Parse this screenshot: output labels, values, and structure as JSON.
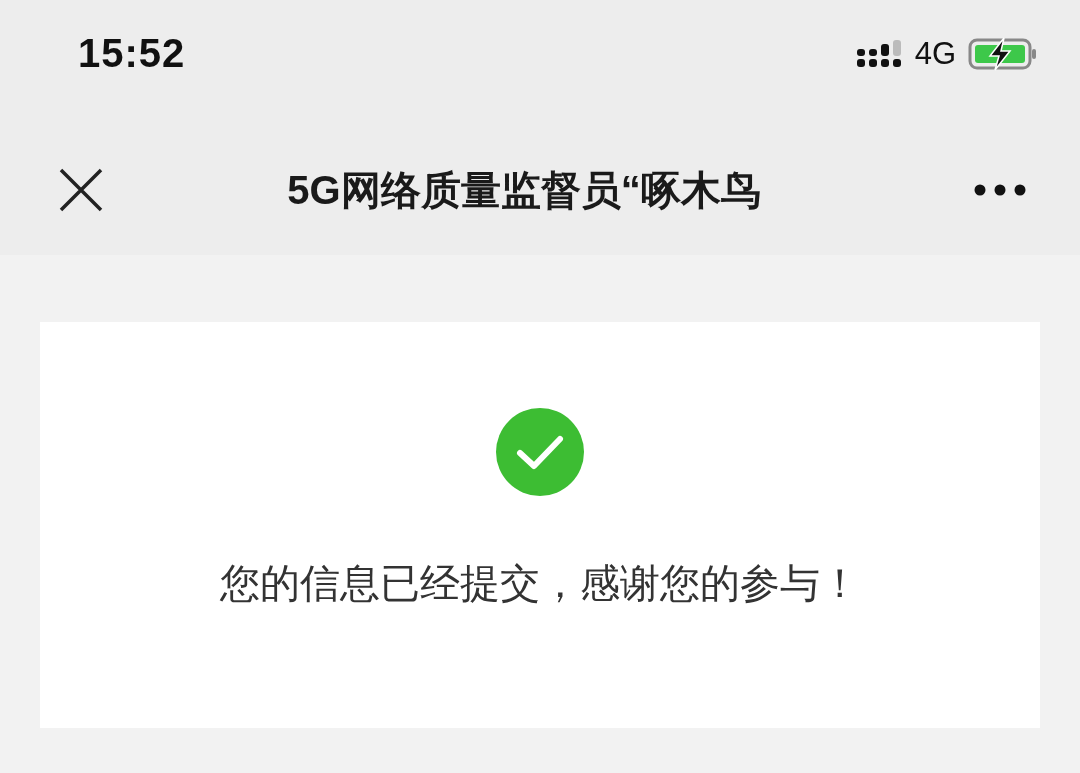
{
  "status_bar": {
    "time": "15:52",
    "network": "4G"
  },
  "nav_bar": {
    "title": "5G网络质量监督员“啄木鸟"
  },
  "result": {
    "message": "您的信息已经提交，感谢您的参与！"
  }
}
